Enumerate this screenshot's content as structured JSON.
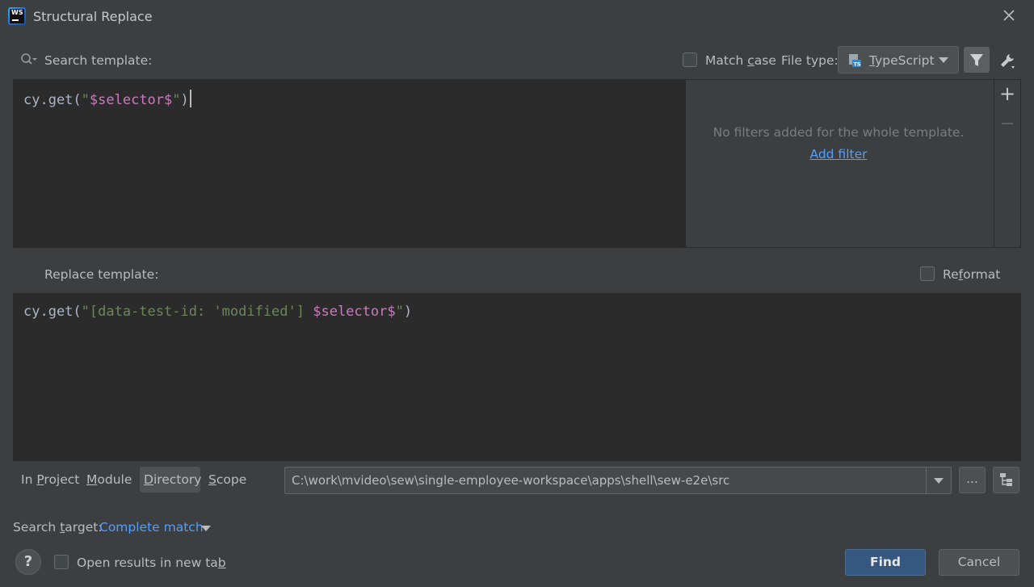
{
  "window": {
    "title": "Structural Replace",
    "close_icon": "close-icon",
    "app_icon": "webstorm-icon"
  },
  "search": {
    "label": "Search template:",
    "match_case": {
      "label_prefix": "Match ",
      "label_mnemonic": "c",
      "label_suffix": "ase",
      "checked": false
    },
    "file_type": {
      "label": "File type:",
      "value_mnemonic": "T",
      "value_rest": "ypeScript"
    },
    "code": {
      "prefix": "cy.get(",
      "quote_open": "\"",
      "var": "$selector$",
      "quote_close": "\"",
      "suffix": ")"
    },
    "filters": {
      "empty_text": "No filters added for the whole template.",
      "add_link": "Add filter"
    }
  },
  "replace": {
    "label": "Replace template:",
    "reformat": {
      "label_prefix": "Re",
      "label_mnemonic": "f",
      "label_suffix": "ormat",
      "checked": false
    },
    "code": {
      "prefix": "cy.get(",
      "string": "\"[data-test-id: 'modified'] ",
      "var": "$selector$",
      "quote_close": "\"",
      "suffix": ")"
    }
  },
  "scope": {
    "tabs": [
      {
        "mn": "",
        "pre": "In ",
        "m": "P",
        "post": "roject"
      },
      {
        "pre": "",
        "m": "M",
        "post": "odule"
      },
      {
        "pre": "",
        "m": "D",
        "post": "irectory"
      },
      {
        "pre": "",
        "m": "S",
        "post": "cope"
      }
    ],
    "selected": "Directory",
    "path": "C:\\work\\mvideo\\sew\\single-employee-workspace\\apps\\shell\\sew-e2e\\src",
    "browse_label": "..."
  },
  "search_target": {
    "label_pre": "Search ",
    "label_m": "t",
    "label_post": "arget:",
    "value": "Complete match"
  },
  "footer": {
    "help_label": "?",
    "open_new_tab": {
      "pre": "Open results in new ta",
      "m": "b",
      "post": "",
      "checked": false
    },
    "find_label": "Find",
    "cancel_label": "Cancel"
  },
  "colors": {
    "background": "#3c3f41",
    "editor": "#2b2b2b",
    "accent": "#589df6",
    "primary_button": "#365880",
    "template_variable": "#c77dbb",
    "string": "#6a8759"
  }
}
